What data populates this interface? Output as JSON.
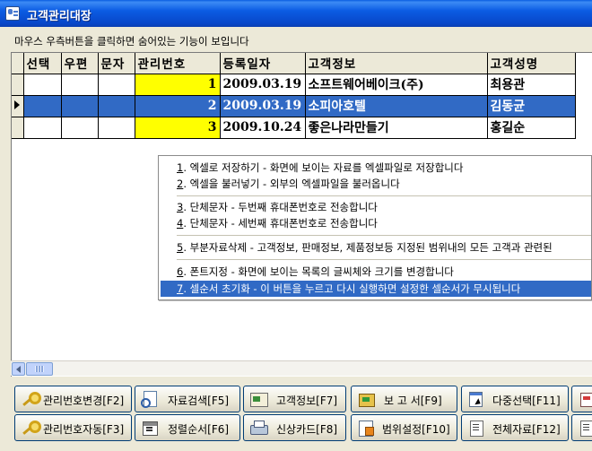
{
  "window": {
    "title": "고객관리대장"
  },
  "hint": "마우스 우측버튼을 클릭하면 숨어있는 기능이 보입니다",
  "grid": {
    "columns": [
      "선택",
      "우편",
      "문자",
      "관리번호",
      "등록일자",
      "고객정보",
      "고객성명"
    ],
    "rows": [
      {
        "select": "",
        "post": "",
        "sms": "",
        "id": "1",
        "date": "2009.03.19",
        "info": "소프트웨어베이크(주)",
        "name": "최용관",
        "selected": false
      },
      {
        "select": "",
        "post": "",
        "sms": "",
        "id": "2",
        "date": "2009.03.19",
        "info": "소피아호텔",
        "name": "김동균",
        "selected": true
      },
      {
        "select": "",
        "post": "",
        "sms": "",
        "id": "3",
        "date": "2009.10.24",
        "info": "좋은나라만들기",
        "name": "홍길순",
        "selected": false
      }
    ],
    "highlight_color": "#ffff00",
    "selection_color": "#316ac5"
  },
  "context_menu": {
    "items": [
      {
        "num": "1",
        "text": ". 엑셀로 저장하기 - 화면에 보이는 자료를 엑셀파일로 저장합니다"
      },
      {
        "num": "2",
        "text": ". 엑셀을 불러넣기 - 외부의 엑셀파일을 불러옵니다"
      },
      {
        "num": "3",
        "text": ". 단체문자 - 두번째 휴대폰번호로 전송합니다"
      },
      {
        "num": "4",
        "text": ". 단체문자 - 세번째 휴대폰번호로 전송합니다"
      },
      {
        "num": "5",
        "text": ". 부분자료삭제 - 고객정보, 판매정보, 제품정보등 지정된 범위내의 모든 고객과 관련된"
      },
      {
        "num": "6",
        "text": ". 폰트지정 - 화면에 보이는 목록의 글씨체와 크기를 변경합니다"
      },
      {
        "num": "7",
        "text": ". 셀순서 초기화 - 이 버튼을 누르고 다시 실행하면 설정한 셀순서가 무시됩니다"
      }
    ]
  },
  "buttons": {
    "row1": [
      {
        "label": "관리번호변경[F2]",
        "icon": "key-icon"
      },
      {
        "label": "자료검색[F5]",
        "icon": "search-icon"
      },
      {
        "label": "고객정보[F7]",
        "icon": "card-icon"
      },
      {
        "label": "보 고 서[F9]",
        "icon": "report-icon"
      },
      {
        "label": "다중선택[F11]",
        "icon": "multi-select-icon"
      }
    ],
    "row2": [
      {
        "label": "관리번호자동[F3]",
        "icon": "key-icon"
      },
      {
        "label": "정렬순서[F6]",
        "icon": "sort-icon"
      },
      {
        "label": "신상카드[F8]",
        "icon": "print-icon"
      },
      {
        "label": "범위설정[F10]",
        "icon": "range-icon"
      },
      {
        "label": "전체자료[F12]",
        "icon": "all-data-icon"
      }
    ]
  }
}
